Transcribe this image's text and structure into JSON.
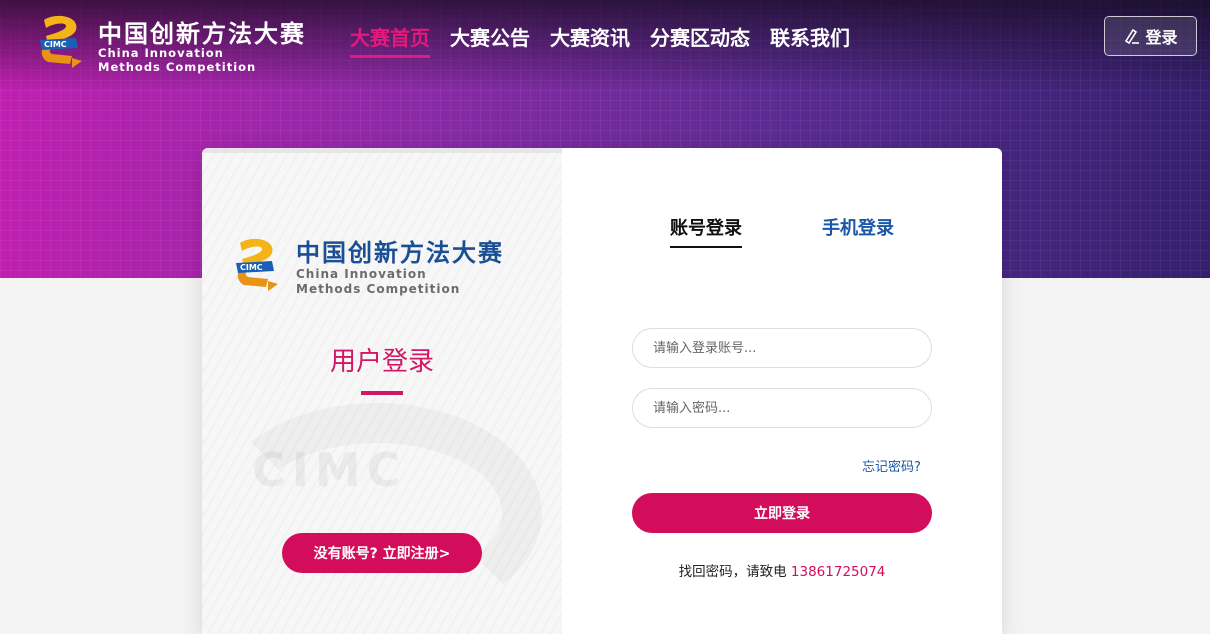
{
  "header": {
    "logo": {
      "cn": "中国创新方法大赛",
      "en_line1": "China Innovation",
      "en_line2": "Methods Competition",
      "mark_text": "CIMC"
    },
    "nav": [
      {
        "label": "大赛首页",
        "active": true
      },
      {
        "label": "大赛公告",
        "active": false
      },
      {
        "label": "大赛资讯",
        "active": false
      },
      {
        "label": "分赛区动态",
        "active": false
      },
      {
        "label": "联系我们",
        "active": false
      }
    ],
    "login_button": {
      "label": "登录",
      "icon": "pen-icon"
    }
  },
  "left_panel": {
    "logo": {
      "cn": "中国创新方法大赛",
      "en_line1": "China Innovation",
      "en_line2": "Methods Competition",
      "mark_text": "CIMC"
    },
    "watermark": "CIMC",
    "title": "用户登录",
    "register_button": "没有账号? 立即注册>"
  },
  "form": {
    "tabs": [
      {
        "label": "账号登录",
        "active": true
      },
      {
        "label": "手机登录",
        "active": false
      }
    ],
    "account_placeholder": "请输入登录账号...",
    "password_placeholder": "请输入密码...",
    "forgot_link": "忘记密码?",
    "submit_button": "立即登录",
    "recover_text": "找回密码，请致电",
    "recover_phone": "13861725074"
  },
  "colors": {
    "accent": "#d20d5b",
    "link_blue": "#1a57a6",
    "hero_start": "#c01fb0",
    "hero_end": "#35206e"
  }
}
